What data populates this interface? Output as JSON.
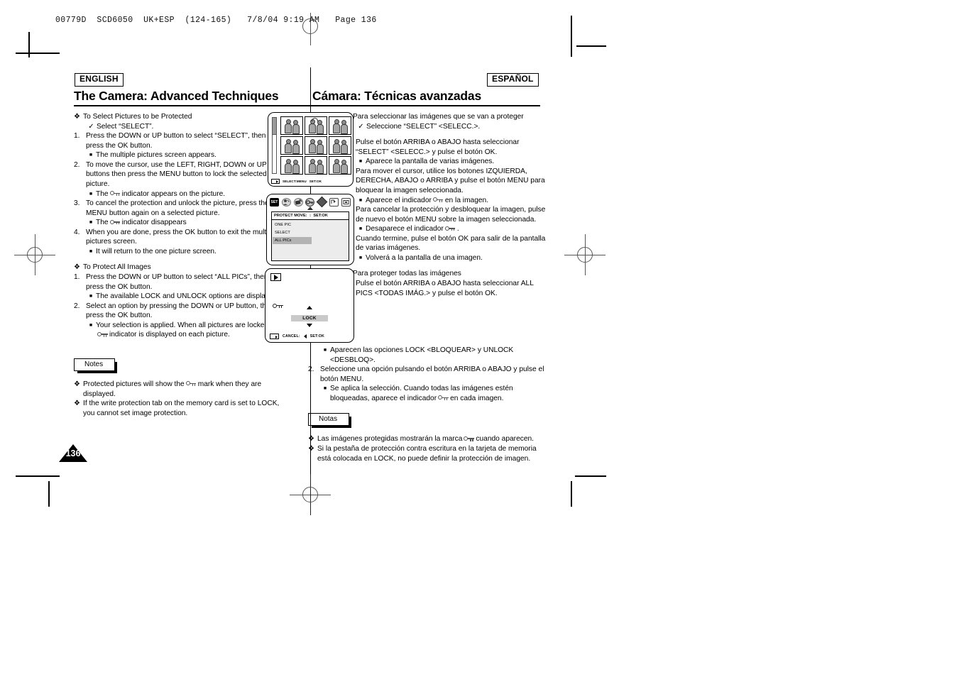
{
  "slug": "00779D  SCD6050  UK+ESP  (124-165)   7/8/04 9:19 AM   Page 136",
  "page_number": "136",
  "header": {
    "english_tag": "ENGLISH",
    "spanish_tag": "ESPAÑOL",
    "english_title": "The Camera: Advanced Techniques",
    "spanish_title": "Cámara: Técnicas avanzadas"
  },
  "english": {
    "section1_heading": "To Select Pictures to be Protected",
    "section1_check": "Select “SELECT”.",
    "s1_step1": "Press the DOWN or UP button to select “SELECT”, then press the OK button.",
    "s1_step1_sub": "The multiple pictures screen appears.",
    "s1_step2": "To move the cursor, use the LEFT, RIGHT, DOWN or UP buttons then press the MENU button to lock the selected picture.",
    "s1_step2_sub_a": "The",
    "s1_step2_sub_b": "indicator appears on the picture.",
    "s1_step3": "To cancel the protection and unlock the picture, press the MENU button again on a selected picture.",
    "s1_step3_sub_a": "The",
    "s1_step3_sub_b": "indicator disappears",
    "s1_step4": "When you are done, press the OK button to exit the multiple pictures screen.",
    "s1_step4_sub": "It will return to the one picture screen.",
    "section2_heading": "To Protect All Images",
    "s2_step1": "Press the DOWN or UP button to select “ALL PICs”, then press the OK button.",
    "s2_step1_sub": "The available LOCK and UNLOCK options are displayed.",
    "s2_step2": "Select an option by pressing the DOWN or UP button, then press the OK button.",
    "s2_step2_sub_a": "Your selection is applied. When all pictures are locked, the",
    "s2_step2_sub_b": "indicator is displayed on each picture.",
    "notes_label": "Notes",
    "note1_a": "Protected pictures will show the",
    "note1_b": "mark when they are displayed.",
    "note2": "If the write protection tab on the memory card is set to LOCK, you cannot set image protection."
  },
  "spanish": {
    "section1_heading": "Para seleccionar las imágenes que se van a proteger",
    "section1_check": "Seleccione “SELECT” <SELECC.>.",
    "s1_step1": "Pulse el botón ARRIBA o ABAJO hasta seleccionar “SELECT” <SELECC.>  y pulse el botón OK.",
    "s1_step1_sub": "Aparece la pantalla de varias imágenes.",
    "s1_step2": "Para mover el cursor, utilice los botones IZQUIERDA, DERECHA, ABAJO o ARRIBA y pulse el botón MENU para bloquear la imagen seleccionada.",
    "s1_step2_sub_a": "Aparece el indicador",
    "s1_step2_sub_b": "en la imagen.",
    "s1_step3": "Para cancelar la protección y desbloquear la imagen, pulse de nuevo el botón MENU sobre la imagen seleccionada.",
    "s1_step3_sub_a": "Desaparece el indicador",
    "s1_step3_sub_b": ".",
    "s1_step4": "Cuando termine, pulse el botón OK para salir de la pantalla de varias imágenes.",
    "s1_step4_sub": "Volverá a la pantalla de una imagen.",
    "section2_heading": "Para proteger todas las imágenes",
    "s2_step1": "Pulse el botón ARRIBA o ABAJO hasta seleccionar ALL PICS <TODAS IMÁG.> y pulse el botón OK.",
    "s2_step1_sub": "Aparecen las opciones LOCK <BLOQUEAR> y UNLOCK <DESBLOQ>.",
    "s2_step2": "Seleccione una opción pulsando el botón ARRIBA o ABAJO y pulse el botón MENU.",
    "s2_step2_sub_a": "Se aplica la selección. Cuando todas las imágenes estén bloqueadas, aparece el indicador",
    "s2_step2_sub_b": "en cada imagen.",
    "notes_label": "Notas",
    "note1_a": "Las imágenes protegidas mostrarán la marca",
    "note1_b": "cuando aparecen.",
    "note2": "Si la pestaña de protección contra escritura en la tarjeta de memoria está colocada en LOCK, no puede definir la protección de imagen."
  },
  "lcd1": {
    "caption_select": "SELECT:MENU",
    "caption_set": "SET:OK",
    "thumbnail_count": 9
  },
  "lcd2": {
    "icons": [
      "set-icon",
      "person-icon",
      "hand-delete-icon",
      "key-protect-icon",
      "multi-direction-icon",
      "copy-icon",
      "monitor-icon"
    ],
    "selected_icon": "key-protect-icon",
    "panel_title": "PROTECT MOVE:",
    "panel_title_set": "SET:OK",
    "options": [
      "ONE PIC",
      "SELECT",
      "ALL PICs"
    ],
    "highlighted_option": "ALL PICs"
  },
  "lcd3": {
    "play_icon": "play-icon",
    "key_icon": "key-indicator-icon",
    "lock_label": "LOCK",
    "caption_cancel": "CANCEL:",
    "caption_set": "SET:OK"
  },
  "colors": {
    "ink": "#000000",
    "lcd_panel": "#ececec",
    "lcd_highlight": "#b3b3b3",
    "thumb_gray": "#a6a6a6"
  }
}
